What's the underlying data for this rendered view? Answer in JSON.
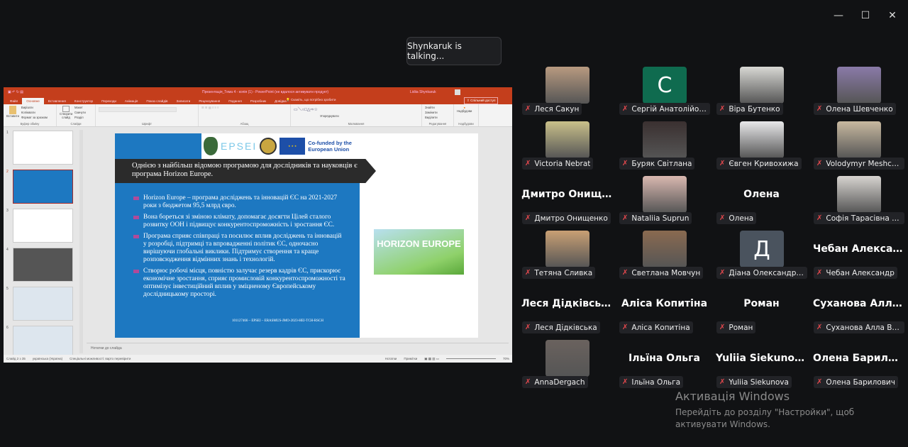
{
  "window": {
    "minimize": "—",
    "maximize": "☐",
    "close": "✕"
  },
  "toast": "Shynkaruk is talking...",
  "ppt": {
    "title": "Презентація_Тема 4 - копія (1) - PowerPoint (не вдалося активувати продукт)",
    "user": "Lidiia Shynkaruk",
    "tabs": [
      "Файл",
      "Основне",
      "Вставлення",
      "Конструктор",
      "Переходи",
      "Анімація",
      "Показ слайдів",
      "Записати",
      "Рецензування",
      "Подання",
      "Розробник",
      "Довідка"
    ],
    "tell_me": "Скажіть, що потрібно зробити",
    "share": "Спільний доступ",
    "ribbon": {
      "paste": "Вставити",
      "cut": "Вирізати",
      "copy": "Копіювати",
      "format_painter": "Формат за зразком",
      "clipboard": "Буфер обміну",
      "new_slide": "Створити слайд",
      "layout": "Макет",
      "reset": "Скинути",
      "section": "Розділ",
      "slides": "Слайди",
      "font": "Шрифт",
      "paragraph": "Абзац",
      "arrange": "Упорядкувати",
      "drawing": "Малювання",
      "find": "Знайти",
      "replace": "Замінити",
      "select": "Виділити",
      "editing": "Редагування",
      "addins": "Надбудови",
      "addins_group": "Надбудови"
    },
    "thumbs": [
      "1",
      "2",
      "3",
      "4",
      "5",
      "6"
    ],
    "slide": {
      "logo_text": "EPSEI",
      "cofunded": "Co-funded by the European Union",
      "heading": "Однією з найбільш відомою програмою для дослідників та науковців є програма Horizon Europe.",
      "bullets": [
        "Horizon Europe – програма досліджень та інновацій ЄС на 2021-2027 роки з бюджетом 95,5 млрд євро.",
        "Вона бореться зі зміною клімату, допомагає досягти Цілей сталого розвитку ООН і підвищує конкурентоспроможність і зростання ЄС.",
        "Програма сприяє співпраці та посилює вплив досліджень та інновацій у розробці, підтримці та впровадженні політик ЄС, одночасно вирішуючи глобальні виклики. Підтримує створення та краще розповсюдження відмінних знань і технологій.",
        "Створює робочі місця, повністю залучає резерв кадрів ЄС, прискорює економічне зростання, сприяє промисловій конкурентоспроможності та оптимізує інвестиційний вплив у зміцненому Європейському дослідницькому просторі."
      ],
      "footer": "101127466 – EPSEI – ERASMUS-JMO-2023-HEI-TCH-RSCH",
      "image_text": "HORIZON EUROPE"
    },
    "notes": "Нотатки до слайда",
    "status": {
      "slide": "Слайд 2 з 35",
      "lang": "українська (Україна)",
      "access": "Спеціальні можливості: варто перевірити",
      "notes": "Нотатки",
      "comments": "Примітки",
      "zoom": "70%"
    }
  },
  "participants": [
    {
      "name": "Леся Сакун",
      "type": "photo",
      "color": "#b89a80"
    },
    {
      "name": "Сергій Анатолійович ...",
      "type": "initial",
      "initial": "С",
      "color": "#0f6b4f"
    },
    {
      "name": "Віра Бутенко",
      "type": "photo",
      "color": "#d8d8d4"
    },
    {
      "name": "Олена Шевченко",
      "type": "photo",
      "color": "#8a7aa8"
    },
    {
      "name": "Victoria Nebrat",
      "type": "photo",
      "color": "#c9c08a"
    },
    {
      "name": "Буряк Світлана",
      "type": "photo",
      "color": "#3a3030"
    },
    {
      "name": "Євген Кривохижа",
      "type": "photo",
      "color": "#e8e8ea"
    },
    {
      "name": "Volodymyr Meshcheri...",
      "type": "photo",
      "color": "#c8b9a0"
    },
    {
      "name": "Дмитро Онищенко",
      "type": "name",
      "display": "Дмитро  Онище..."
    },
    {
      "name": "Nataliia Suprun",
      "type": "photo",
      "color": "#d9b8b0"
    },
    {
      "name": "Олена",
      "type": "name",
      "display": "Олена"
    },
    {
      "name": "Софія Тарасівна Брун...",
      "type": "photo",
      "color": "#d7d4d0"
    },
    {
      "name": "Тетяна Сливка",
      "type": "photo",
      "color": "#c9a074"
    },
    {
      "name": "Светлана Мовчун",
      "type": "photo",
      "color": "#8a6a50"
    },
    {
      "name": "Діана Олександрівна І...",
      "type": "initial",
      "initial": "Д",
      "color": "#4a535e"
    },
    {
      "name": "Чебан Александр",
      "type": "name",
      "display": "Чебан  Алексан..."
    },
    {
      "name": "Леся Дідківська",
      "type": "name",
      "display": "Леся Дідківська"
    },
    {
      "name": "Аліса Копитіна",
      "type": "name",
      "display": "Аліса Копитіна"
    },
    {
      "name": "Роман",
      "type": "name",
      "display": "Роман"
    },
    {
      "name": "Суханова Алла Валерії...",
      "type": "name",
      "display": "Суханова  Алла..."
    },
    {
      "name": "AnnaDergach",
      "type": "photo",
      "color": "#6a625e"
    },
    {
      "name": "Ільїна Ольга",
      "type": "name",
      "display": "Ільїна Ольга"
    },
    {
      "name": "Yuliia Siekunova",
      "type": "name",
      "display": "Yuliia Siekunova"
    },
    {
      "name": "Олена Барилович",
      "type": "name",
      "display": "Олена  Барилов..."
    }
  ],
  "activation": {
    "title": "Активація Windows",
    "text": "Перейдіть до розділу \"Настройки\", щоб активувати Windows."
  }
}
